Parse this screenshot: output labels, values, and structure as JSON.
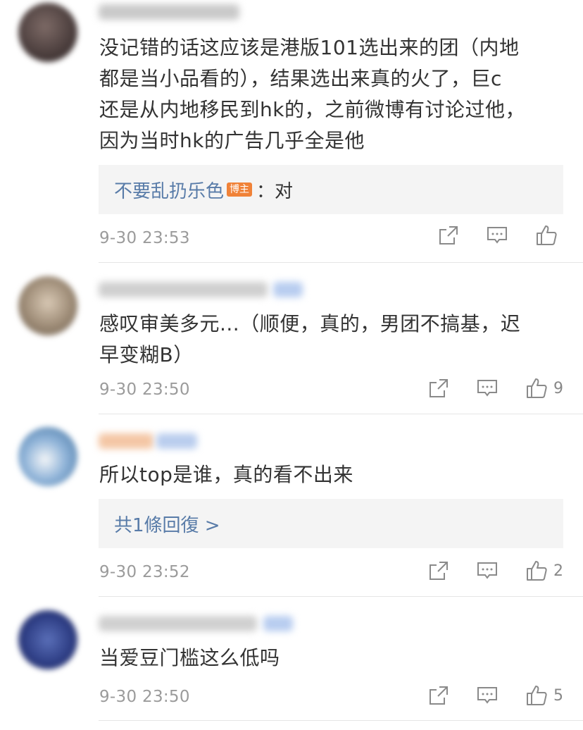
{
  "comments": [
    {
      "text": "没记错的话这应该是港版101选出来的团（内地\n都是当小品看的），结果选出来真的火了，巨c\n还是从内地移民到hk的，之前微博有讨论过他，\n因为当时hk的广告几乎全是他",
      "reply": {
        "name": "不要乱扔乐色",
        "badge": "博主",
        "text": "：对"
      },
      "time": "9-30 23:53",
      "likes": ""
    },
    {
      "text": "感叹审美多元...（顺便，真的，男团不搞基，迟\n早变糊B）",
      "time": "9-30 23:50",
      "likes": "9"
    },
    {
      "text": "所以top是谁，真的看不出来",
      "replies_link": "共1條回復 >",
      "time": "9-30 23:52",
      "likes": "2"
    },
    {
      "text": "当爱豆门槛这么低吗",
      "time": "9-30 23:50",
      "likes": "5"
    }
  ],
  "icons": {
    "share": "share-icon",
    "comment": "comment-icon",
    "like": "like-icon"
  },
  "colors": {
    "link": "#587ba8",
    "badge": "#f08238",
    "meta": "#9b9b9b",
    "reply_bg": "#f4f4f4"
  }
}
